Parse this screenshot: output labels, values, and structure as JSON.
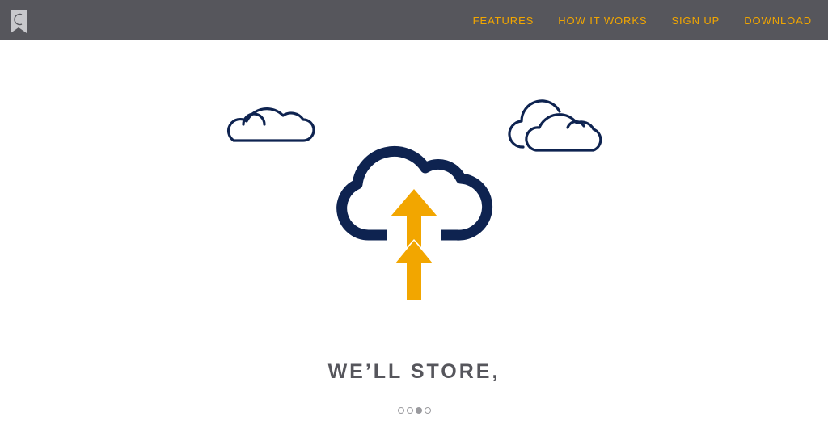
{
  "header": {
    "logo_icon": "bookmark-c-logo-icon",
    "background": "#56565c",
    "accent": "#f2a600"
  },
  "nav": {
    "items": [
      {
        "label": "FEATURES"
      },
      {
        "label": "HOW IT WORKS"
      },
      {
        "label": "SIGN UP"
      },
      {
        "label": "DOWNLOAD"
      }
    ]
  },
  "hero": {
    "icons": [
      "cloud-icon",
      "double-cloud-icon",
      "cloud-upload-icon"
    ],
    "headline": "WE’LL STORE,",
    "cloud_color": "#0e2350",
    "arrow_color": "#f2a600"
  },
  "carousel": {
    "count": 4,
    "active_index": 2
  }
}
